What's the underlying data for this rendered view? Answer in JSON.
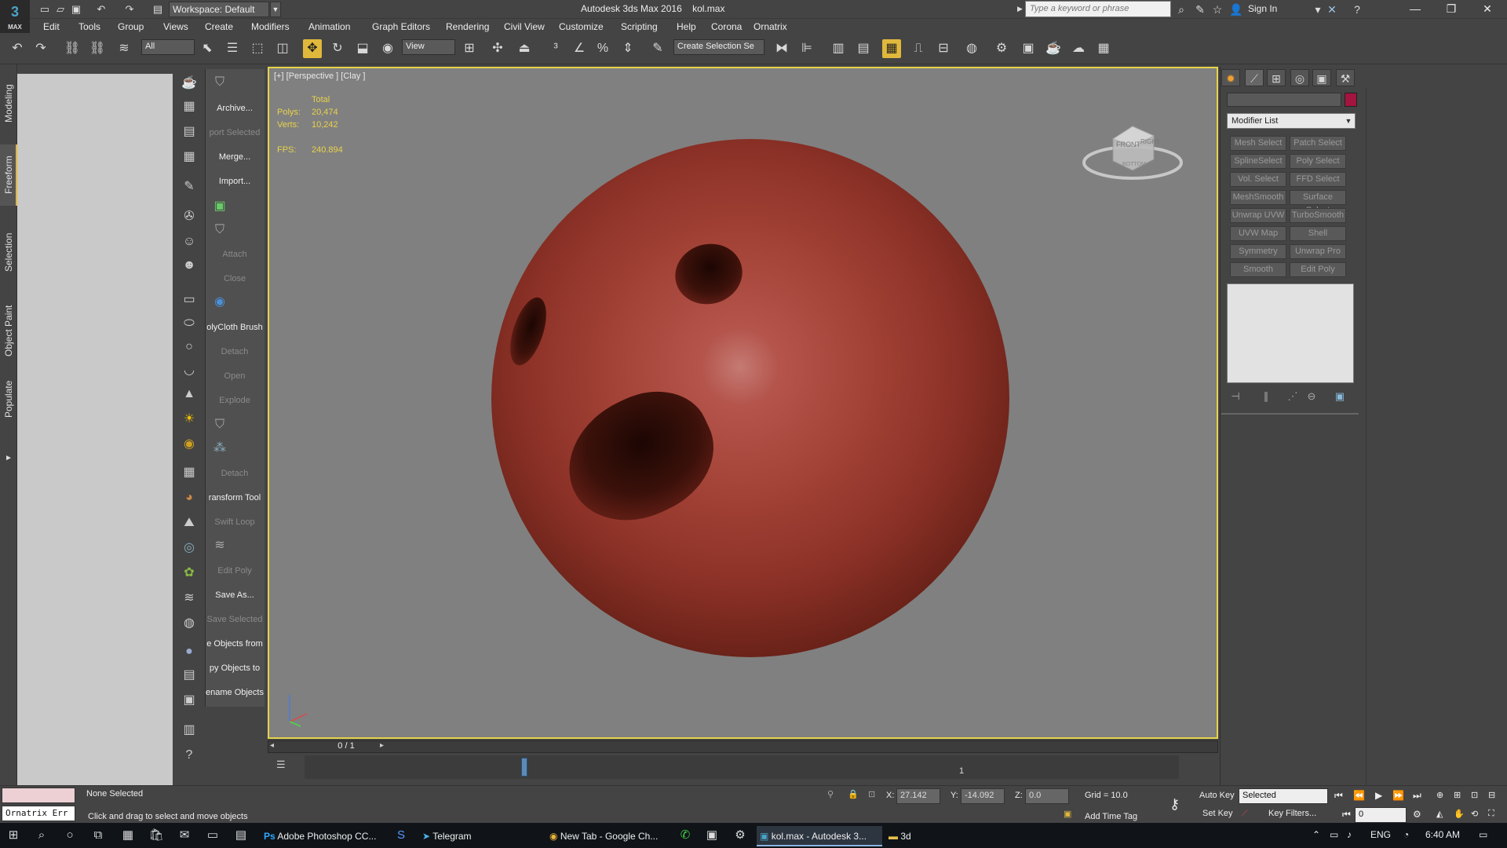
{
  "window": {
    "app_title": "Autodesk 3ds Max 2016",
    "file_name": "kol.max"
  },
  "app_logo": {
    "text": "3",
    "caption": "MAX"
  },
  "workspace": {
    "label": "Workspace: Default"
  },
  "search": {
    "placeholder": "Type a keyword or phrase"
  },
  "account": {
    "sign_in": "Sign In"
  },
  "menu": [
    "Edit",
    "Tools",
    "Group",
    "Views",
    "Create",
    "Modifiers",
    "Animation",
    "Graph Editors",
    "Rendering",
    "Civil View",
    "Customize",
    "Scripting",
    "Help",
    "Corona",
    "Ornatrix"
  ],
  "toolbar": {
    "filter_value": "All",
    "ref_coord_value": "View",
    "selection_set_placeholder": "Create Selection Se"
  },
  "left_tabs": [
    "Modeling",
    "Freeform",
    "Selection",
    "Object Paint",
    "Populate"
  ],
  "tool_column": {
    "items": [
      {
        "label": "Archive...",
        "enabled": true
      },
      {
        "label": "port Selected",
        "enabled": false
      },
      {
        "label": "Merge...",
        "enabled": true
      },
      {
        "label": "Import...",
        "enabled": true
      },
      {
        "label": "Attach",
        "enabled": false
      },
      {
        "label": "Close",
        "enabled": false
      },
      {
        "label": "olyCloth Brush",
        "enabled": true
      },
      {
        "label": "Detach",
        "enabled": false
      },
      {
        "label": "Open",
        "enabled": false
      },
      {
        "label": "Explode",
        "enabled": false
      },
      {
        "label": "Detach",
        "enabled": false
      },
      {
        "label": "ransform Tool",
        "enabled": true
      },
      {
        "label": "Swift Loop",
        "enabled": false
      },
      {
        "label": "Edit Poly",
        "enabled": false
      },
      {
        "label": "Save As...",
        "enabled": true
      },
      {
        "label": "Save Selected",
        "enabled": false
      },
      {
        "label": "e Objects from",
        "enabled": true
      },
      {
        "label": "py Objects to",
        "enabled": true
      },
      {
        "label": "ename Objects",
        "enabled": true
      }
    ]
  },
  "viewport": {
    "label": "[+] [Perspective ] [Clay ]",
    "stats": {
      "header": "Total",
      "polys_label": "Polys:",
      "polys": "20,474",
      "verts_label": "Verts:",
      "verts": "10,242",
      "fps_label": "FPS:",
      "fps": "240.894"
    },
    "viewcube": {
      "front": "FRONT",
      "right": "RIGHT",
      "bottom": "BOTTOM"
    }
  },
  "time_slider": {
    "frame": "0 / 1",
    "frame_marker": "1"
  },
  "command_panel": {
    "modifier_list": "Modifier List",
    "modifier_buttons": [
      "Mesh Select",
      "Patch Select",
      "SplineSelect",
      "Poly Select",
      "Vol. Select",
      "FFD Select",
      "MeshSmooth",
      "Surface Select",
      "Unwrap UVW",
      "TurboSmooth",
      "UVW Map",
      "Shell",
      "Symmetry",
      "Unwrap Pro",
      "Smooth",
      "Edit Poly"
    ]
  },
  "status": {
    "listener": "Ornatrix Err",
    "selection": "None Selected",
    "prompt": "Click and drag to select and move objects",
    "x_label": "X:",
    "x": "27.142",
    "y_label": "Y:",
    "y": "-14.092",
    "z_label": "Z:",
    "z": "0.0",
    "grid": "Grid = 10.0",
    "add_time_tag": "Add Time Tag",
    "auto_key": "Auto Key",
    "set_key": "Set Key",
    "selected_value": "Selected",
    "key_filters": "Key Filters...",
    "current_frame": "0"
  },
  "taskbar": {
    "apps": [
      "Adobe Photoshop CC...",
      "Telegram",
      "New Tab - Google Ch...",
      "kol.max - Autodesk 3...",
      "3d"
    ],
    "language": "ENG",
    "time": "6:40 AM"
  },
  "colors": {
    "viewport_border": "#e7d34a",
    "ball": "#a34236",
    "stats_text": "#e8d24a",
    "object_color": "#a3143f"
  }
}
